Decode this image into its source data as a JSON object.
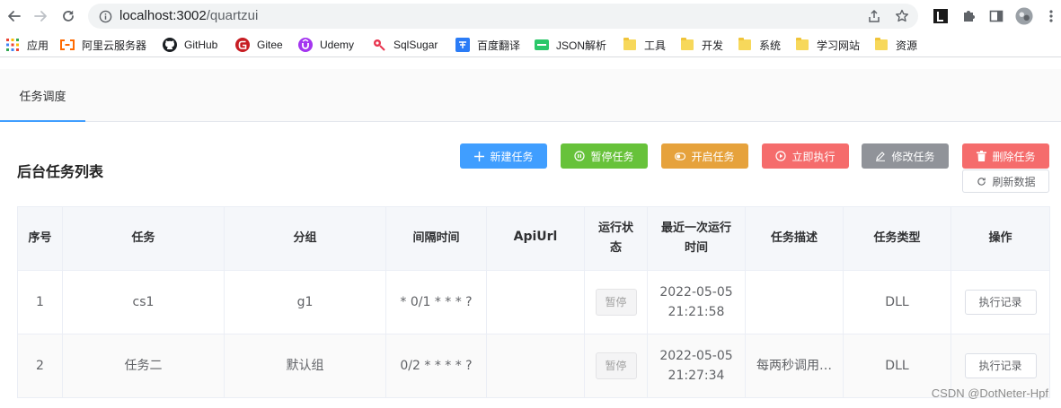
{
  "browser": {
    "url_host": "localhost:3002",
    "url_path": "/quartzui",
    "bookmarks": [
      {
        "label": "应用",
        "icon": "apps-grid-icon"
      },
      {
        "label": "阿里云服务器",
        "icon": "aliyun-icon"
      },
      {
        "label": "GitHub",
        "icon": "github-icon"
      },
      {
        "label": "Gitee",
        "icon": "gitee-icon"
      },
      {
        "label": "Udemy",
        "icon": "udemy-icon"
      },
      {
        "label": "SqlSugar",
        "icon": "sqlsugar-icon"
      },
      {
        "label": "百度翻译",
        "icon": "baidu-translate-icon"
      },
      {
        "label": "JSON解析",
        "icon": "json-icon"
      },
      {
        "label": "工具",
        "icon": "folder-icon"
      },
      {
        "label": "开发",
        "icon": "folder-icon"
      },
      {
        "label": "系统",
        "icon": "folder-icon"
      },
      {
        "label": "学习网站",
        "icon": "folder-icon"
      },
      {
        "label": "资源",
        "icon": "folder-icon"
      }
    ]
  },
  "tabs": [
    {
      "label": "任务调度",
      "active": true
    }
  ],
  "page": {
    "title": "后台任务列表"
  },
  "actions": {
    "new_task": "新建任务",
    "pause_task": "暂停任务",
    "start_task": "开启任务",
    "run_now": "立即执行",
    "edit_task": "修改任务",
    "delete_task": "删除任务",
    "refresh": "刷新数据"
  },
  "table": {
    "headers": {
      "index": "序号",
      "task": "任务",
      "group": "分组",
      "interval": "间隔时间",
      "api_url": "ApiUrl",
      "status_l1": "运行状",
      "status_l2": "态",
      "last_run_l1": "最近一次运行",
      "last_run_l2": "时间",
      "description": "任务描述",
      "type": "任务类型",
      "operation": "操作"
    },
    "rows": [
      {
        "index": "1",
        "task": "cs1",
        "group": "g1",
        "interval": "* 0/1 * * * ?",
        "api_url": "",
        "status": "暂停",
        "last_run_date": "2022-05-05",
        "last_run_time": "21:21:58",
        "description": "",
        "type": "DLL",
        "action": "执行记录"
      },
      {
        "index": "2",
        "task": "任务二",
        "group": "默认组",
        "interval": "0/2 * * * * ?",
        "api_url": "",
        "status": "暂停",
        "last_run_date": "2022-05-05",
        "last_run_time": "21:27:34",
        "description": "每两秒调用…",
        "type": "DLL",
        "action": "执行记录"
      }
    ]
  },
  "watermark": "CSDN @DotNeter-Hpf",
  "colors": {
    "primary": "#409eff",
    "success": "#67c23a",
    "warning": "#e6a23c",
    "danger": "#f56c6c",
    "info": "#909399"
  }
}
